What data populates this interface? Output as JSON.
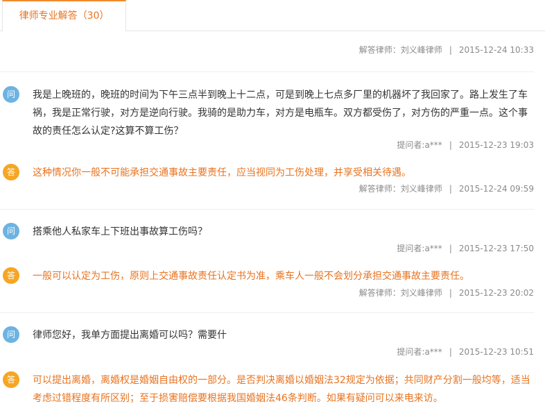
{
  "tab": {
    "label": "律师专业解答（30）"
  },
  "top_partial_meta": {
    "answerer": "解答律师：刘义峰律师",
    "date": "2015-12-24 10:33"
  },
  "items": [
    {
      "question": "我是上晚班的，晚班的时间为下午三点半到晚上十二点，可是到晚上七点多厂里的机器坏了我回家了。路上发生了车祸，我是正常行驶，对方是逆向行驶。我骑的是助力车，对方是电瓶车。双方都受伤了，对方伤的严重一点。这个事故的责任怎么认定?这算不算工伤？",
      "asker": "提问者:a***",
      "ask_date": "2015-12-23 19:03",
      "answer": "这种情况你一般不可能承担交通事故主要责任，应当视同为工伤处理，并享受相关待遇。",
      "answerer": "解答律师：刘义峰律师",
      "answer_date": "2015-12-24 09:59"
    },
    {
      "question": "搭乘他人私家车上下班出事故算工伤吗？",
      "asker": "提问者:a***",
      "ask_date": "2015-12-23 17:50",
      "answer": "一般可以认定为工伤，原则上交通事故责任认定书为准，乘车人一般不会划分承担交通事故主要责任。",
      "answerer": "解答律师：刘义峰律师",
      "answer_date": "2015-12-23 20:02"
    },
    {
      "question": "律师您好，我单方面提出离婚可以吗？需要什",
      "asker": "提问者:a***",
      "ask_date": "2015-12-23 10:51",
      "answer": "可以提出离婚，离婚权是婚姻自由权的一部分。是否判决离婚以婚姻法32规定为依据；共同财产分割一般均等，适当考虑过错程度有所区别；至于损害赔偿要根据我国婚姻法46条判断。如果有疑问可以来电来访。"
    }
  ],
  "labels": {
    "question_badge": "问",
    "answer_badge": "答",
    "separator": "|"
  },
  "colors": {
    "accent": "#e8731f",
    "question_badge": "#6db3e2",
    "answer_badge": "#f5a623"
  }
}
